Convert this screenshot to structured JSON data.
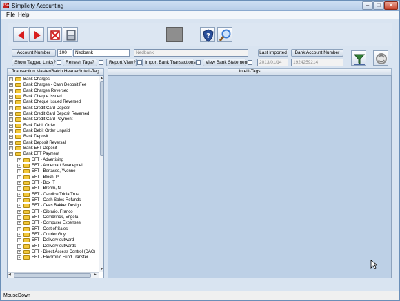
{
  "window": {
    "title": "Simplicity Accounting",
    "app_icon_text": "ISA",
    "controls": {
      "minimize": "–",
      "maximize": "□",
      "close": "✕"
    }
  },
  "menu": [
    "File",
    "Help"
  ],
  "toolbar": {
    "buttons": [
      "prev-record-icon",
      "next-record-icon",
      "delete-icon",
      "save-icon",
      "blank-gray-icon",
      "help-shield-icon",
      "search-magnifier-icon"
    ],
    "colors": {
      "arrows": "#d81e1e",
      "help": "#2a4f9a",
      "search": "#3a7bd5"
    }
  },
  "form": {
    "account_number_label": "Account Number",
    "account_number_value": "100",
    "account_name_value": "Nedbank",
    "account_name_readonly": "Nedbank",
    "last_imported_label": "Last Imported",
    "last_imported_value": "2013/01/14",
    "bank_account_number_label": "Bank Account Number",
    "bank_account_number_value": "1924259214",
    "checks": {
      "show_tagged_links": "Show Tagged Links?",
      "refresh_tags": "Refresh Tags?",
      "report_view": "Report View?",
      "import_bank_transactions": "Import Bank Transactions?",
      "view_bank_statement": "View Bank Statement?"
    }
  },
  "panels": {
    "tree_header": "Transaction Master/Batch Header/Intelli-Tag",
    "intelli_header": "Intelli-Tags"
  },
  "tree": {
    "top_level": [
      "Bank Charges",
      "Bank Charges - Cash Deposit Fee",
      "Bank Charges Reversed",
      "Bank Cheque Issued",
      "Bank Cheque Issued Reversed",
      "Bank Credit Card Deposit",
      "Bank Credit Card Deposit Reversed",
      "Bank Credit Card Payment",
      "Bank Debit Order",
      "Bank Debit Order Unpaid",
      "Bank Deposit",
      "Bank Deposit Reversal",
      "Bank EFT Deposit",
      "Bank EFT Payment"
    ],
    "children": [
      "EFT - Advertising",
      "EFT - Annemart Swanepoel",
      "EFT - Bertasso, Yvonne",
      "EFT - Bloch, P",
      "EFT - Box IT",
      "EFT - Brehm, N",
      "EFT - Candice Tricia Trust",
      "EFT - Cash Sales Refunds",
      "EFT - Cees Bakker Design",
      "EFT - Cibrario, Franco",
      "EFT - Combrinck, Engela",
      "EFT - Computer Expenses",
      "EFT - Cost of Sales",
      "EFT - Courier Guy",
      "EFT - Delivery outward",
      "EFT - Delivery outwards",
      "EFT - Direct Access Control (DAC)",
      "EFT - Electronic Fund Transfer"
    ]
  },
  "status": {
    "text": "MouseDown"
  }
}
